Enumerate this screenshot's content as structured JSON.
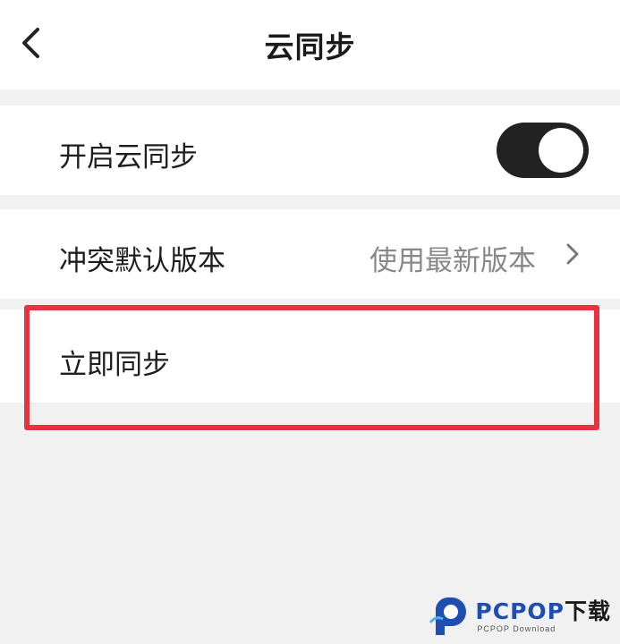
{
  "header": {
    "title": "云同步",
    "back_icon": "chevron-left-icon"
  },
  "settings": {
    "cloud_sync": {
      "label": "开启云同步",
      "enabled": true
    },
    "conflict_default": {
      "label": "冲突默认版本",
      "value": "使用最新版本",
      "icon": "chevron-right-icon"
    },
    "sync_now": {
      "label": "立即同步"
    }
  },
  "highlight_color": "#e8323f",
  "watermark": {
    "brand": "PCPOP",
    "brand_suffix": "下载",
    "sub": "PCPOP Download",
    "color": "#1f4fae"
  }
}
